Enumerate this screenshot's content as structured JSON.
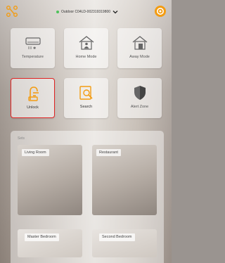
{
  "header": {
    "device_name": "Outdoor C04LD-002319319800",
    "status_color": "#4ec25a",
    "menu_icon": "connected-nodes-icon",
    "settings_icon": "gear-icon",
    "accent": "#f39c12"
  },
  "tiles": [
    {
      "label": "Temperature",
      "icon": "air-conditioner-icon"
    },
    {
      "label": "Home Mode",
      "icon": "home-person-icon"
    },
    {
      "label": "Away Mode",
      "icon": "home-door-icon"
    },
    {
      "label": "Unlock",
      "icon": "unlock-icon"
    },
    {
      "label": "Search",
      "icon": "search-doc-icon"
    },
    {
      "label": "Alert Zone",
      "icon": "shield-icon"
    }
  ],
  "rooms": {
    "title": "Sets",
    "items": [
      {
        "label": "Living Room"
      },
      {
        "label": "Restaurant"
      },
      {
        "label": "Master Bedroom"
      },
      {
        "label": "Second Bedroom"
      }
    ]
  }
}
